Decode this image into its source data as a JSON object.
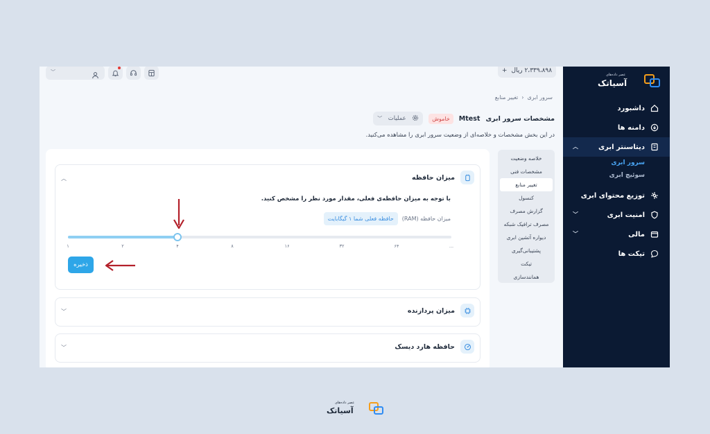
{
  "brand": {
    "name": "آسیاتک",
    "tagline": "عصر داده‌های"
  },
  "sidebar": {
    "items": [
      {
        "label": "داشبورد",
        "icon": "home-icon"
      },
      {
        "label": "دامنه ها",
        "icon": "globe-icon"
      },
      {
        "label": "دیتاسنتر ابری",
        "icon": "building-icon",
        "active": true,
        "children": [
          {
            "label": "سرور ابری",
            "active": true
          },
          {
            "label": "سوئیچ ابری"
          }
        ]
      },
      {
        "label": "توزیع محتوای ابری",
        "icon": "network-icon"
      },
      {
        "label": "امنیت ابری",
        "icon": "shield-icon"
      },
      {
        "label": "مالی",
        "icon": "wallet-icon"
      },
      {
        "label": "تیکت ها",
        "icon": "chat-icon"
      }
    ]
  },
  "topbar": {
    "balance": "۲،۳۳۹،۸۹۸ ریال",
    "balance_plus": "+"
  },
  "breadcrumb": {
    "parent": "سرور ابری",
    "separator": "‹",
    "current": "تغییر منابع"
  },
  "header": {
    "title": "مشخصات سرور ابری",
    "server_name": "Mtest",
    "status": "خاموش",
    "ops_label": "عملیات",
    "description": "در این بخش مشخصات و خلاصه‌ای از وضعیت سرور ابری را مشاهده می‌کنید."
  },
  "tabs": [
    {
      "label": "خلاصه وضعیت"
    },
    {
      "label": "مشخصات فنی"
    },
    {
      "label": "تغییر منابع",
      "active": true
    },
    {
      "label": "کنسول"
    },
    {
      "label": "گزارش مصرف"
    },
    {
      "label": "مصرف ترافیک شبکه"
    },
    {
      "label": "دیواره آتشین ابری"
    },
    {
      "label": "پشتیبانی‌گیری"
    },
    {
      "label": "تیکت"
    },
    {
      "label": "همانندسازی"
    }
  ],
  "memory": {
    "title": "میزان حافظه",
    "note": "با توجه به میزان حافظه‌ی فعلی، مقدار مورد نظر را مشخص کنید.",
    "ram_label": "میزان حافظه (RAM)",
    "current_pill": "حافظه فعلی شما ۱ گیگابایت",
    "ticks": [
      "۱",
      "۲",
      "۴",
      "۸",
      "۱۶",
      "۳۲",
      "۶۴",
      "..."
    ],
    "selected_index": 2,
    "save_label": "ذخیره"
  },
  "cpu": {
    "title": "میزان پردازنده"
  },
  "disk": {
    "title": "حافظه هارد دیسک"
  },
  "colors": {
    "sidebar_bg": "#0b1a33",
    "accent": "#2ea6e8",
    "arrow": "#b3202a",
    "off_badge": "#d04848"
  }
}
